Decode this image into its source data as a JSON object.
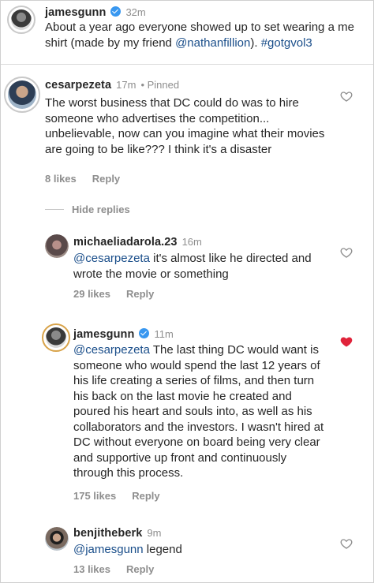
{
  "post": {
    "username": "jamesgunn",
    "time": "32m",
    "text_a": "About a year ago everyone showed up to set wearing a me shirt (made by my friend ",
    "mention": "@nathanfillion",
    "text_b": "). ",
    "hashtag": "#gotgvol3"
  },
  "comments": [
    {
      "username": "cesarpezeta",
      "time": "17m",
      "pinned": "• Pinned",
      "text": "The worst business that DC could do was to hire someone who advertises the competition... unbelievable, now can you imagine what their movies are going to be like??? I think it's a disaster",
      "likes": "8 likes",
      "reply": "Reply",
      "liked": false
    }
  ],
  "hide_replies": "Hide replies",
  "replies": [
    {
      "username": "michaeliadarola.23",
      "time": "16m",
      "mention": "@cesarpezeta",
      "text": " it's almost like he directed and wrote the movie or something",
      "likes": "29 likes",
      "reply": "Reply",
      "liked": false
    },
    {
      "username": "jamesgunn",
      "time": "11m",
      "mention": "@cesarpezeta",
      "text": " The last thing DC would want is someone who would spend the last 12 years of his life creating a series of films, and then turn his back on the last movie he created and poured his heart and souls into, as well as his collaborators and the investors. I wasn't hired at DC without everyone on board being very clear and supportive up front and continuously through this process.",
      "likes": "175 likes",
      "reply": "Reply",
      "liked": true
    },
    {
      "username": "benjitheberk",
      "time": "9m",
      "mention": "@jamesgunn",
      "text": " legend",
      "likes": "13 likes",
      "reply": "Reply",
      "liked": false
    }
  ],
  "colors": {
    "heart_liked": "#e0233a",
    "heart_outline": "#8e8e8e",
    "verified": "#3897f0",
    "mention": "#1a4e8a"
  }
}
